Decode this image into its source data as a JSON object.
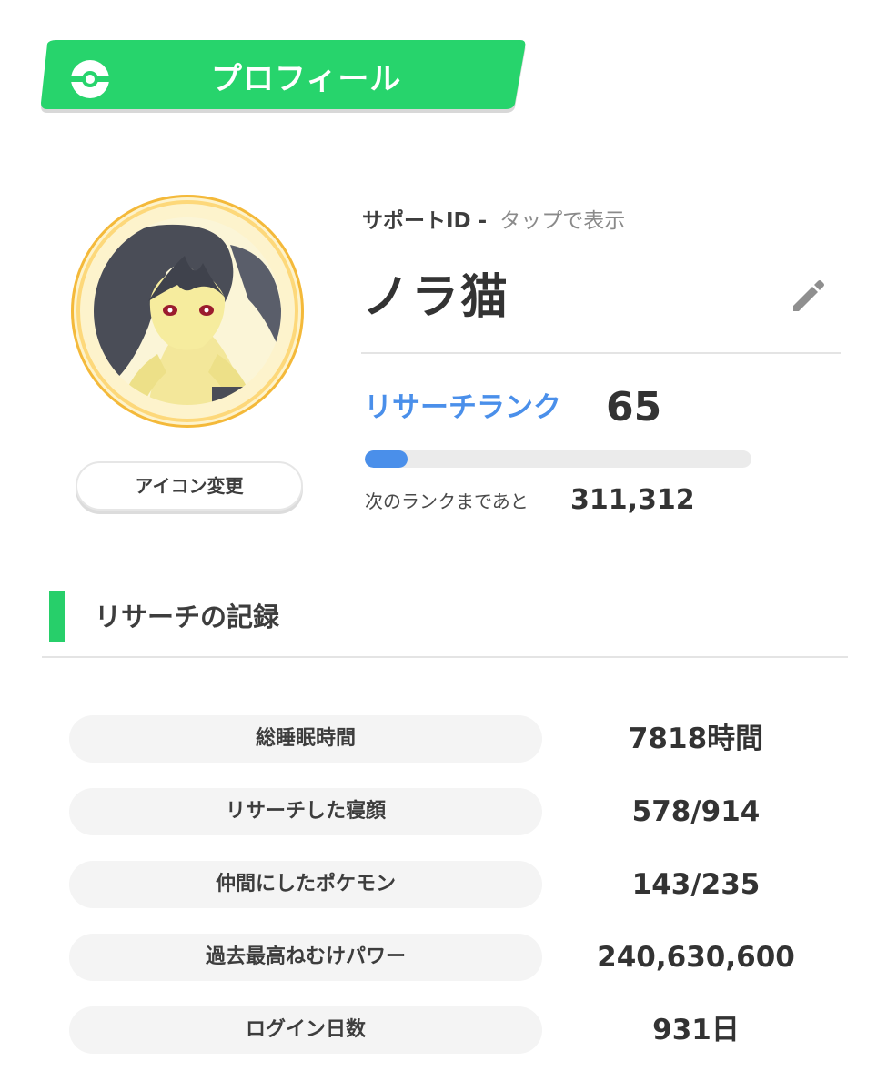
{
  "header": {
    "title": "プロフィール",
    "icon": "poke-ball-icon",
    "color": "#27d46c"
  },
  "profile": {
    "avatar_icon": "mawile-avatar",
    "change_icon_label": "アイコン変更",
    "support_id_label": "サポートID -",
    "support_id_tap": "タップで表示",
    "name": "ノラ猫",
    "edit_icon": "pencil-icon"
  },
  "rank": {
    "label": "リサーチランク",
    "value": "65",
    "progress_fraction": 0.11,
    "next_label": "次のランクまであと",
    "next_value": "311,312",
    "accent": "#4a8fea"
  },
  "records": {
    "title": "リサーチの記録",
    "accent": "#27cf6a",
    "items": [
      {
        "label": "総睡眠時間",
        "value": "7818時間"
      },
      {
        "label": "リサーチした寝顔",
        "value": "578/914"
      },
      {
        "label": "仲間にしたポケモン",
        "value": "143/235"
      },
      {
        "label": "過去最高ねむけパワー",
        "value": "240,630,600"
      },
      {
        "label": "ログイン日数",
        "value": "931日"
      }
    ]
  }
}
